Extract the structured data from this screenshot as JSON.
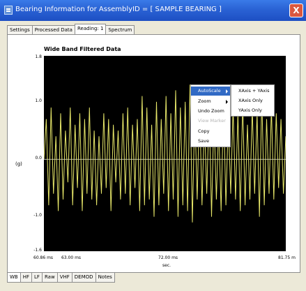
{
  "window": {
    "title": "Bearing Information for AssemblyID = [ SAMPLE BEARING ]",
    "close_glyph": "X"
  },
  "top_tabs": [
    "Settings",
    "Processed Data",
    "Reading: 1",
    "Spectrum"
  ],
  "active_top_tab": 2,
  "chart": {
    "title": "Wide Band Filtered Data",
    "ylabel": "(g)",
    "xlabel": "sec."
  },
  "chart_data": {
    "type": "line",
    "title": "Wide Band Filtered Data",
    "xlabel": "sec.",
    "ylabel": "(g)",
    "x_tick_labels": [
      "60.86 ms",
      "63.00 ms",
      "72.00 ms",
      "81.75 m"
    ],
    "y_tick_labels": [
      "1.8",
      "1.0",
      "0.0",
      "-1.0",
      "-1.6"
    ],
    "xlim": [
      60.86,
      81.75
    ],
    "ylim": [
      -1.6,
      1.8
    ],
    "x_unit": "ms",
    "background": "#000000",
    "grid": false,
    "series": [
      {
        "color": "#e8e86a",
        "values": [
          0.0,
          0.7,
          -0.8,
          0.9,
          -0.6,
          0.4,
          -0.9,
          0.8,
          -0.7,
          0.5,
          -0.4,
          0.9,
          -0.8,
          0.6,
          -0.5,
          0.8,
          -0.9,
          0.7,
          -0.6,
          0.9,
          -0.7,
          0.5,
          -0.8,
          0.4,
          -0.6,
          0.8,
          -0.5,
          0.7,
          -0.9,
          0.6,
          -0.4,
          0.5,
          -0.7,
          0.8,
          -0.6,
          0.9,
          -0.8,
          0.6,
          -0.5,
          0.7,
          -0.9,
          1.1,
          -0.8,
          0.9,
          -0.7,
          0.6,
          -1.0,
          1.0,
          -0.8,
          0.7,
          -0.6,
          1.1,
          -0.9,
          0.8,
          -0.7,
          1.2,
          -1.0,
          0.9,
          -0.8,
          1.0,
          -0.9,
          1.3,
          -1.1,
          0.9,
          -0.7,
          1.0,
          -0.8,
          0.7,
          -0.6,
          0.9,
          -1.0,
          0.8,
          -0.7,
          0.6,
          -0.9,
          1.0,
          -0.8,
          0.7,
          -0.6,
          0.9,
          -0.7,
          0.8,
          -0.9,
          1.0,
          -0.8,
          0.6,
          -0.7,
          0.9,
          -0.6,
          0.8,
          -1.0,
          1.1,
          -0.8,
          0.7,
          -0.6,
          0.9,
          -0.7,
          0.8,
          -0.5,
          0.7,
          -0.6,
          0.4
        ]
      },
      {
        "color": "#f2f2f2",
        "values": [
          0.0,
          0.0
        ]
      }
    ]
  },
  "context_menu": {
    "items": [
      {
        "label": "AutoScale",
        "submenu": true,
        "highlighted": true,
        "disabled": false
      },
      {
        "label": "Zoom",
        "submenu": true,
        "highlighted": false,
        "disabled": false
      },
      {
        "label": "Undo Zoom",
        "submenu": false,
        "highlighted": false,
        "disabled": false
      },
      {
        "label": "View Marker",
        "submenu": false,
        "highlighted": false,
        "disabled": true
      },
      {
        "label": "Copy",
        "submenu": false,
        "highlighted": false,
        "disabled": false
      },
      {
        "label": "Save",
        "submenu": false,
        "highlighted": false,
        "disabled": false
      }
    ]
  },
  "sub_menu": {
    "items": [
      "XAxis + YAxis",
      "XAxis Only",
      "YAxis Only"
    ]
  },
  "bottom_tabs": [
    "WB",
    "HF",
    "LF",
    "Raw",
    "VHF",
    "DEMOD",
    "Notes"
  ],
  "active_bottom_tab": 0
}
